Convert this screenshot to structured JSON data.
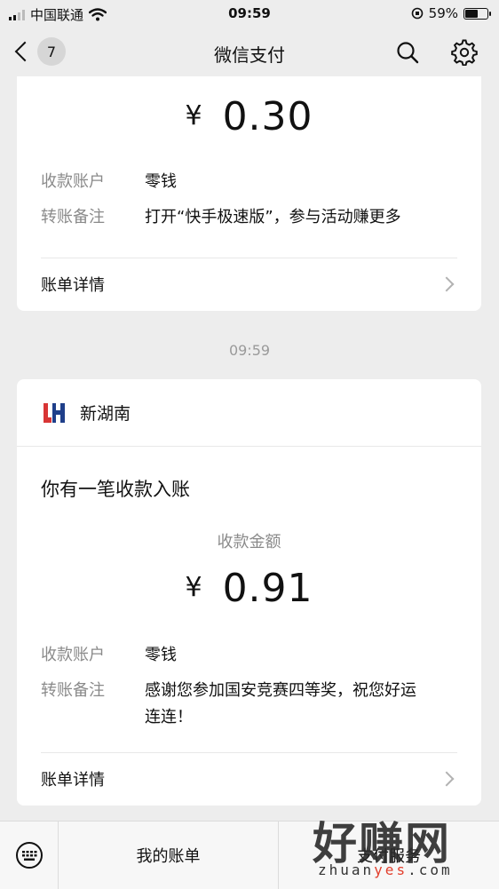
{
  "status_bar": {
    "carrier": "中国联通",
    "time": "09:59",
    "battery": "59%"
  },
  "nav": {
    "unread_count": "7",
    "title": "微信支付",
    "search_icon": "search-icon",
    "settings_icon": "gear-icon"
  },
  "card1": {
    "currency": "¥",
    "amount": "0.30",
    "account_label": "收款账户",
    "account_value": "零钱",
    "remark_label": "转账备注",
    "remark_value": "打开“快手极速版”，参与活动赚更多",
    "detail_label": "账单详情"
  },
  "timestamp": "09:59",
  "card2": {
    "sender": "新湖南",
    "headline": "你有一笔收款入账",
    "amount_label": "收款金额",
    "currency": "¥",
    "amount": "0.91",
    "account_label": "收款账户",
    "account_value": "零钱",
    "remark_label": "转账备注",
    "remark_line1": "感谢您参加国安竞赛四等奖，祝您好运",
    "remark_line2": "连连！",
    "detail_label": "账单详情"
  },
  "bottom_bar": {
    "menu_1": "我的账单",
    "menu_2": "支付服务"
  },
  "watermark": {
    "big": "好赚网",
    "small_a": "zhuan",
    "small_b": "yes",
    "small_c": ".com"
  }
}
